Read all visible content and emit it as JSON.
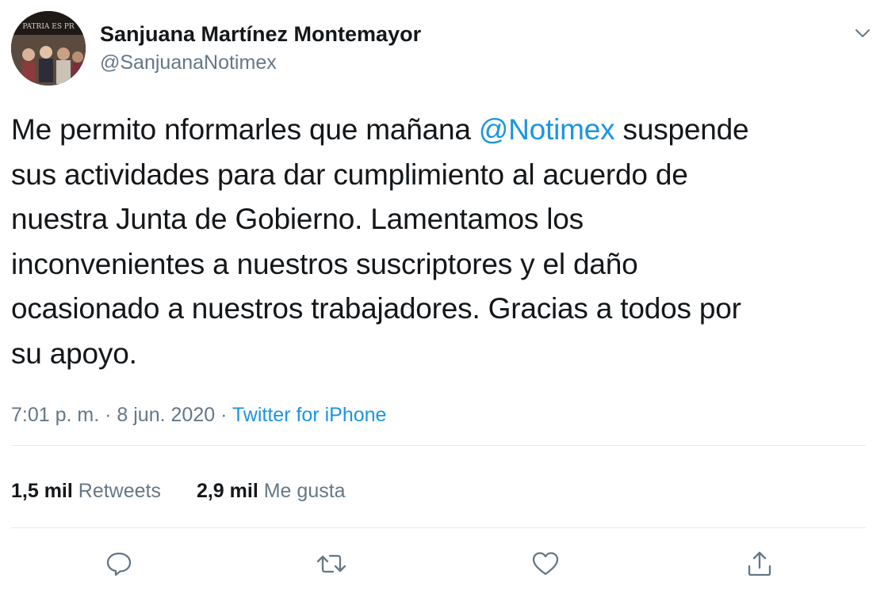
{
  "author": {
    "display_name": "Sanjuana Martínez Montemayor",
    "handle": "@SanjuanaNotimex",
    "avatar_text": "PATRIA ES PR"
  },
  "tweet": {
    "lines": [
      {
        "before": "Me permito nformarles que mañana ",
        "mention": "@Notimex",
        "after": " suspende"
      },
      {
        "text": "sus actividades para dar cumplimiento al acuerdo de"
      },
      {
        "text": "nuestra Junta de Gobierno. Lamentamos los"
      },
      {
        "text": "inconvenientes a nuestros suscriptores y el daño"
      },
      {
        "text": "ocasionado a nuestros trabajadores. Gracias a todos por"
      },
      {
        "text": "su apoyo."
      }
    ]
  },
  "meta": {
    "time": "7:01 p. m.",
    "separator": "·",
    "date": "8 jun. 2020",
    "source": "Twitter for iPhone"
  },
  "stats": {
    "retweets_count": "1,5 mil",
    "retweets_label": "Retweets",
    "likes_count": "2,9 mil",
    "likes_label": "Me gusta"
  },
  "icons": {
    "caret": "chevron-down-icon",
    "reply": "reply-icon",
    "retweet": "retweet-icon",
    "like": "heart-icon",
    "share": "share-icon"
  },
  "colors": {
    "link": "#1b95e0",
    "secondary_text": "#657786",
    "primary_text": "#14171a",
    "divider": "#e6ecf0"
  }
}
